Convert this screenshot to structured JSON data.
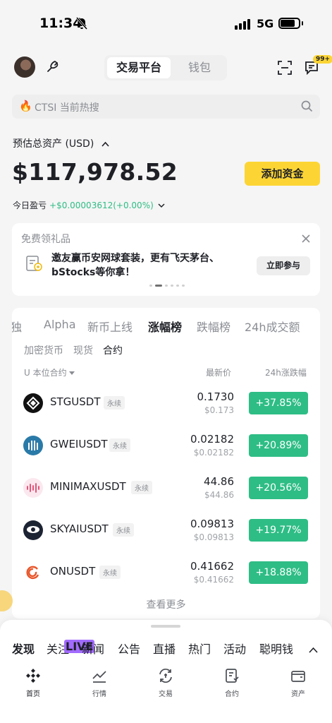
{
  "status_bar": {
    "time": "11:34",
    "network": "5G",
    "icons": [
      "bell-off-icon",
      "signal-icon",
      "battery-icon"
    ]
  },
  "header": {
    "tabs": [
      {
        "label": "交易平台",
        "active": true
      },
      {
        "label": "钱包",
        "active": false
      }
    ],
    "notification_badge": "99+",
    "icons": [
      "avatar",
      "guide-icon",
      "scan-icon",
      "message-icon"
    ]
  },
  "search": {
    "placeholder": "CTSI 当前热搜"
  },
  "account": {
    "estimated_label": "预估总资产 (USD)",
    "balance": "$117,978.52",
    "deposit_label": "添加资金",
    "pnl_label": "今日盈亏",
    "pnl_value": "+$0.00003612(+0.00%)"
  },
  "promo": {
    "title": "免费领礼品",
    "description": "邀友赢币安网球套装，更有飞天茅台、bStocks等你拿！",
    "join_label": "立即参与"
  },
  "market": {
    "tabs": [
      "独",
      "Alpha",
      "新币上线",
      "涨幅榜",
      "跌幅榜",
      "24h成交额"
    ],
    "active_tab": "涨幅榜",
    "subtabs": [
      "加密货币",
      "现货",
      "合约"
    ],
    "active_subtab": "合约",
    "filter_label": "U 本位合约",
    "col_price": "最新价",
    "col_change": "24h涨跌幅",
    "perpetual_tag": "永续",
    "rows": [
      {
        "symbol": "STGUSDT",
        "price": "0.1730",
        "usd": "$0.173",
        "change": "+37.85%"
      },
      {
        "symbol": "GWEIUSDT",
        "price": "0.02182",
        "usd": "$0.02182",
        "change": "+20.89%"
      },
      {
        "symbol": "MINIMAXUSDT",
        "price": "44.86",
        "usd": "$44.86",
        "change": "+20.56%"
      },
      {
        "symbol": "SKYAIUSDT",
        "price": "0.09813",
        "usd": "$0.09813",
        "change": "+19.77%"
      },
      {
        "symbol": "ONUSDT",
        "price": "0.41662",
        "usd": "$0.41662",
        "change": "+18.88%"
      }
    ],
    "more_label": "查看更多",
    "up_color": "#2ebd85"
  },
  "feed_tabs": {
    "items": [
      "发现",
      "关注",
      "新闻",
      "公告",
      "直播",
      "热门",
      "活动",
      "聪明钱"
    ],
    "live_badge": "LIVE"
  },
  "bottom_nav": [
    {
      "label": "首页",
      "icon": "home-icon",
      "active": true
    },
    {
      "label": "行情",
      "icon": "markets-icon",
      "active": false
    },
    {
      "label": "交易",
      "icon": "trade-icon",
      "active": false
    },
    {
      "label": "合约",
      "icon": "futures-icon",
      "active": false
    },
    {
      "label": "资产",
      "icon": "wallet-icon",
      "active": false
    }
  ],
  "colors": {
    "brand": "#fcd535",
    "up": "#2ebd85",
    "text": "#1e2026",
    "muted": "#8a8d93"
  }
}
